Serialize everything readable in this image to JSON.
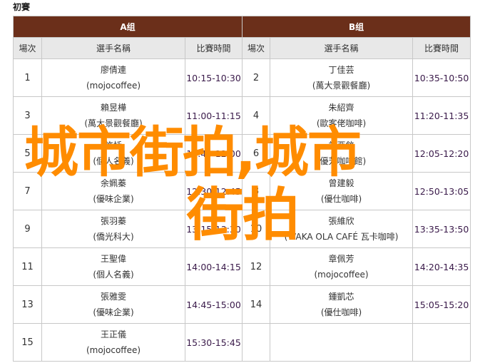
{
  "section_title": "初賽",
  "groups": [
    {
      "label": "A组"
    },
    {
      "label": "B组"
    }
  ],
  "column_headers": {
    "match": "場次",
    "player": "選手名稱",
    "time": "比賽時間"
  },
  "group_a": [
    {
      "match": "1",
      "name": "廖倩連",
      "org": "(mojocoffee)",
      "time": "10:15-10:30"
    },
    {
      "match": "3",
      "name": "賴昱樺",
      "org": "(萬大景觀餐廳)",
      "time": "11:00-11:15"
    },
    {
      "match": "5",
      "name": "許恬",
      "org": "(個人名義)",
      "time": "11:40-12:00"
    },
    {
      "match": "7",
      "name": "余姵蓁",
      "org": "(優味企業)",
      "time": "12:30-12:45"
    },
    {
      "match": "9",
      "name": "張羽蓁",
      "org": "(僑光科大)",
      "time": "13:15-13:30"
    },
    {
      "match": "11",
      "name": "王聖偉",
      "org": "(個人名義)",
      "time": "14:00-14:15"
    },
    {
      "match": "13",
      "name": "張雅雯",
      "org": "(優味企業)",
      "time": "14:45-15:00"
    },
    {
      "match": "15",
      "name": "王正儀",
      "org": "(mojocoffee)",
      "time": "15:30-15:45"
    }
  ],
  "group_b": [
    {
      "match": "2",
      "name": "丁佳芸",
      "org": "(萬大景觀餐廳)",
      "time": "10:35-10:50"
    },
    {
      "match": "4",
      "name": "朱紹齊",
      "org": "(歐客佬咖啡)",
      "time": "11:20-11:35"
    },
    {
      "match": "6",
      "name": "祁亞斂",
      "org": "(優芳咖啡館)",
      "time": "12:05-12:20"
    },
    {
      "match": "8",
      "name": "曾建毅",
      "org": "(優仕咖啡)",
      "time": "12:50-13:05"
    },
    {
      "match": "10",
      "name": "張維欣",
      "org": "(WAKA OLA CAFÉ 瓦卡咖啡)",
      "time": "13:35-13:50"
    },
    {
      "match": "12",
      "name": "章佩芳",
      "org": "(mojocoffee)",
      "time": "14:20-14:35"
    },
    {
      "match": "14",
      "name": "鍾凱芯",
      "org": "(優仕咖啡)",
      "time": "15:05-15:20"
    },
    {
      "match": "",
      "name": "",
      "org": "",
      "time": ""
    }
  ],
  "watermark": {
    "line1": "城市街拍,城市",
    "line2": "街拍",
    "color": "#ff8c00"
  },
  "colors": {
    "group_header_bg": "#6b2f1a",
    "column_header_bg": "#e8e8e8",
    "border": "#c8c8c8"
  }
}
